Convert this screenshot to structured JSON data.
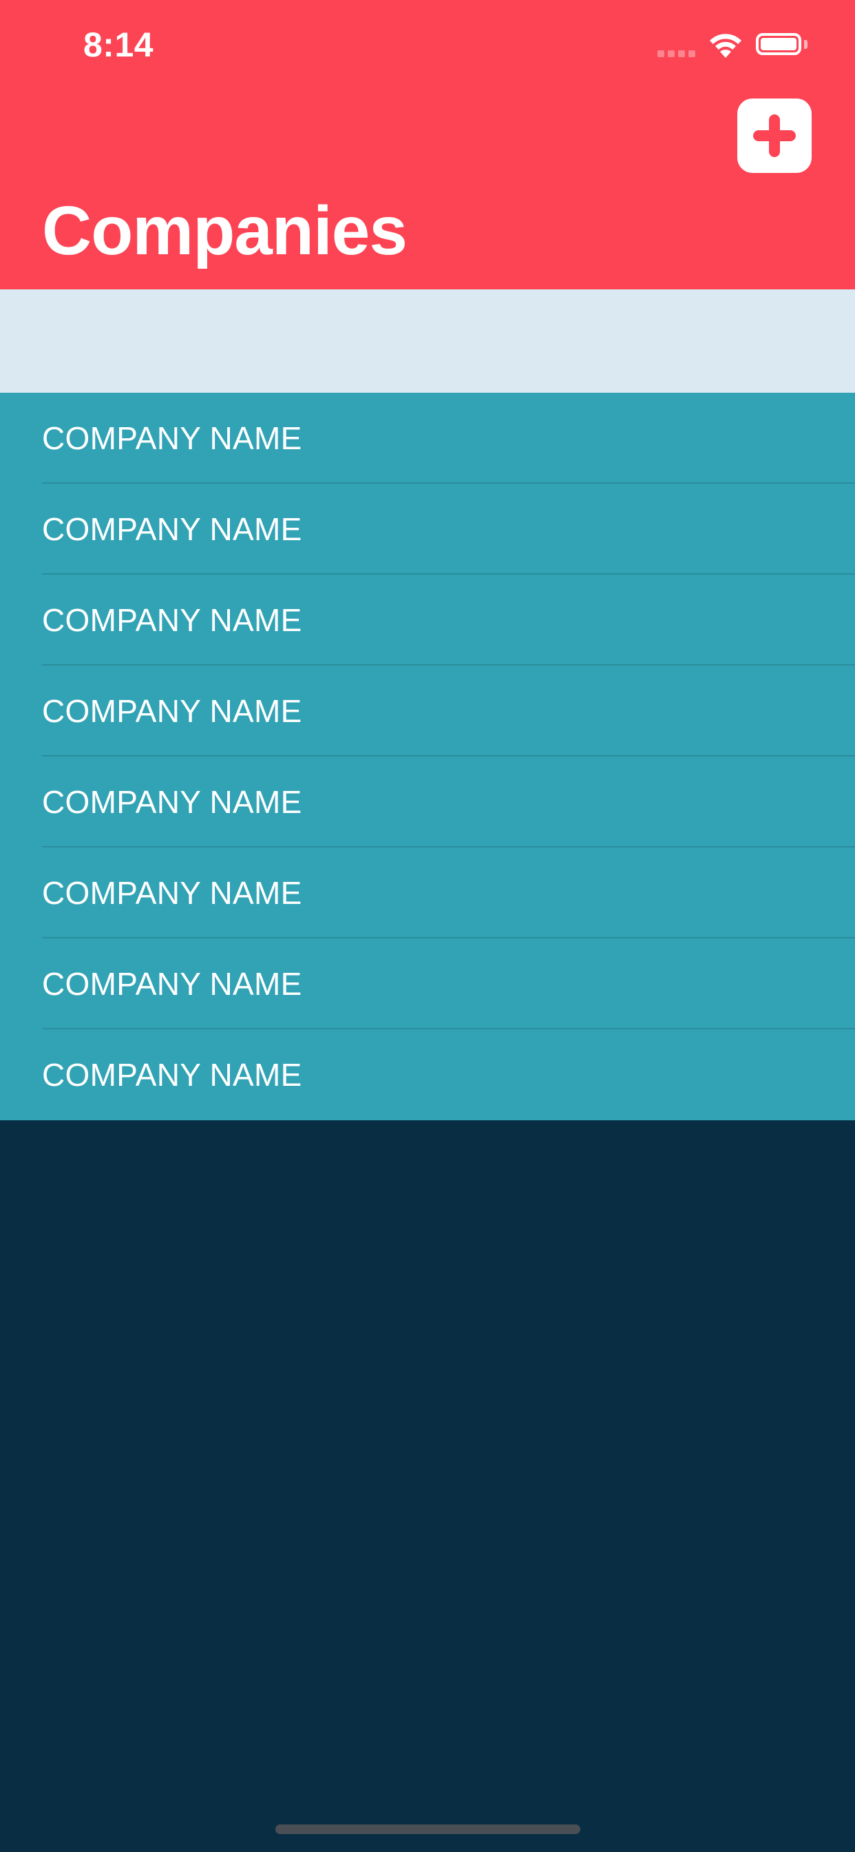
{
  "status_bar": {
    "time": "8:14"
  },
  "nav": {
    "title": "Companies",
    "add_button_icon": "plus-icon"
  },
  "companies": [
    {
      "name": "COMPANY NAME"
    },
    {
      "name": "COMPANY NAME"
    },
    {
      "name": "COMPANY NAME"
    },
    {
      "name": "COMPANY NAME"
    },
    {
      "name": "COMPANY NAME"
    },
    {
      "name": "COMPANY NAME"
    },
    {
      "name": "COMPANY NAME"
    },
    {
      "name": "COMPANY NAME"
    }
  ],
  "colors": {
    "header": "#fc4454",
    "header_spacer": "#dbeaf2",
    "list_background": "#31a3b5",
    "page_background": "#092d42",
    "accent": "#fc4454"
  }
}
